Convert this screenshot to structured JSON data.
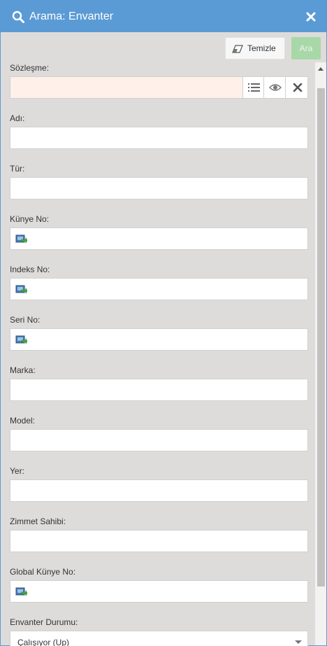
{
  "window": {
    "title": "Arama: Envanter",
    "title_icon": "search-icon",
    "close_icon": "close-icon"
  },
  "toolbar": {
    "clear_label": "Temizle",
    "clear_icon": "eraser-icon",
    "search_label": "Ara"
  },
  "fields": {
    "contract": {
      "label": "Sözleşme:",
      "value": "",
      "icons": [
        "list-icon",
        "eye-icon",
        "clear-x-icon"
      ]
    },
    "name": {
      "label": "Adı:",
      "value": ""
    },
    "type": {
      "label": "Tür:",
      "value": ""
    },
    "tag_no": {
      "label": "Künye No:",
      "value": "",
      "icon": "barcode-scan-icon"
    },
    "index_no": {
      "label": "Indeks No:",
      "value": "",
      "icon": "barcode-scan-icon"
    },
    "serial_no": {
      "label": "Seri No:",
      "value": "",
      "icon": "barcode-scan-icon"
    },
    "brand": {
      "label": "Marka:",
      "value": ""
    },
    "model": {
      "label": "Model:",
      "value": ""
    },
    "location": {
      "label": "Yer:",
      "value": ""
    },
    "assignee": {
      "label": "Zimmet Sahibi:",
      "value": ""
    },
    "global_tag_no": {
      "label": "Global Künye No:",
      "value": "",
      "icon": "barcode-scan-icon"
    },
    "inventory_status": {
      "label": "Envanter Durumu:",
      "selected": "Çalışıyor (Up)"
    }
  },
  "colors": {
    "title_bar": "#5b9bd5",
    "panel_bg": "#dedcda",
    "invalid_field_bg": "#fff0ea",
    "search_button_bg": "#a8d8a8"
  }
}
